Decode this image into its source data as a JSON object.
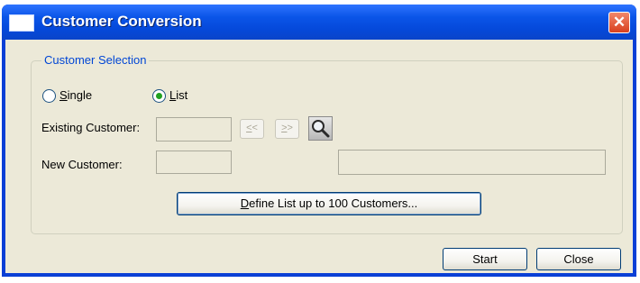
{
  "window": {
    "title": "Customer Conversion",
    "close_glyph": "✕"
  },
  "group": {
    "legend": "Customer Selection"
  },
  "mode": {
    "single_label_first": "S",
    "single_label_rest": "ingle",
    "list_label_first": "L",
    "list_label_rest": "ist",
    "selected": "List"
  },
  "fields": {
    "existing_label": "Existing Customer:",
    "existing_value": "",
    "new_label": "New Customer:",
    "new_value": "",
    "new_name_value": ""
  },
  "nav": {
    "prev_label_first": "<",
    "prev_label_rest": "<",
    "next_label_first": ">",
    "next_label_rest": ">"
  },
  "define_button": {
    "first": "D",
    "rest": "efine List up to 100 Customers..."
  },
  "actions": {
    "start": "Start",
    "close": "Close"
  },
  "colors": {
    "title_bar": "#0b55e8",
    "dialog_bg": "#ece9d8",
    "legend_text": "#0046d5",
    "radio_dot": "#21a121"
  }
}
